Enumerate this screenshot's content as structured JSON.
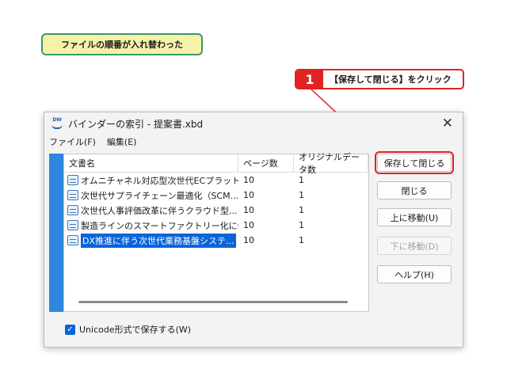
{
  "caption": {
    "text": "ファイルの順番が入れ替わった"
  },
  "callout": {
    "number": "1",
    "text": "【保存して閉じる】をクリック"
  },
  "window": {
    "icon_text": "DW",
    "title": "バインダーの索引 - 提案書.xbd",
    "close_glyph": "✕",
    "menu": [
      "ファイル(F)",
      "編集(E)"
    ]
  },
  "table": {
    "columns": [
      "文書名",
      "ページ数",
      "オリジナルデータ数"
    ],
    "rows": [
      {
        "name": "オムニチャネル対応型次世代ECプラット...",
        "pages": "10",
        "original": "1",
        "selected": false
      },
      {
        "name": "次世代サプライチェーン最適化（SCM...",
        "pages": "10",
        "original": "1",
        "selected": false
      },
      {
        "name": "次世代人事評価改革に伴うクラウド型...",
        "pages": "10",
        "original": "1",
        "selected": false
      },
      {
        "name": "製造ラインのスマートファクトリー化に伴う...",
        "pages": "10",
        "original": "1",
        "selected": false
      },
      {
        "name": "DX推進に伴う次世代業務基盤システ...",
        "pages": "10",
        "original": "1",
        "selected": true
      }
    ]
  },
  "buttons": {
    "save_close": "保存して閉じる",
    "close": "閉じる",
    "move_up": "上に移動(U)",
    "move_down": "下に移動(D)",
    "help": "ヘルプ(H)"
  },
  "checkbox": {
    "label": "Unicode形式で保存する(W)",
    "checked": true,
    "mark": "✓"
  },
  "colors": {
    "accent_red": "#e02323",
    "selection_blue": "#0a64d8",
    "strip_blue": "#2e86de",
    "caption_bg": "#f6f2a8",
    "caption_border": "#3a9a6a"
  }
}
